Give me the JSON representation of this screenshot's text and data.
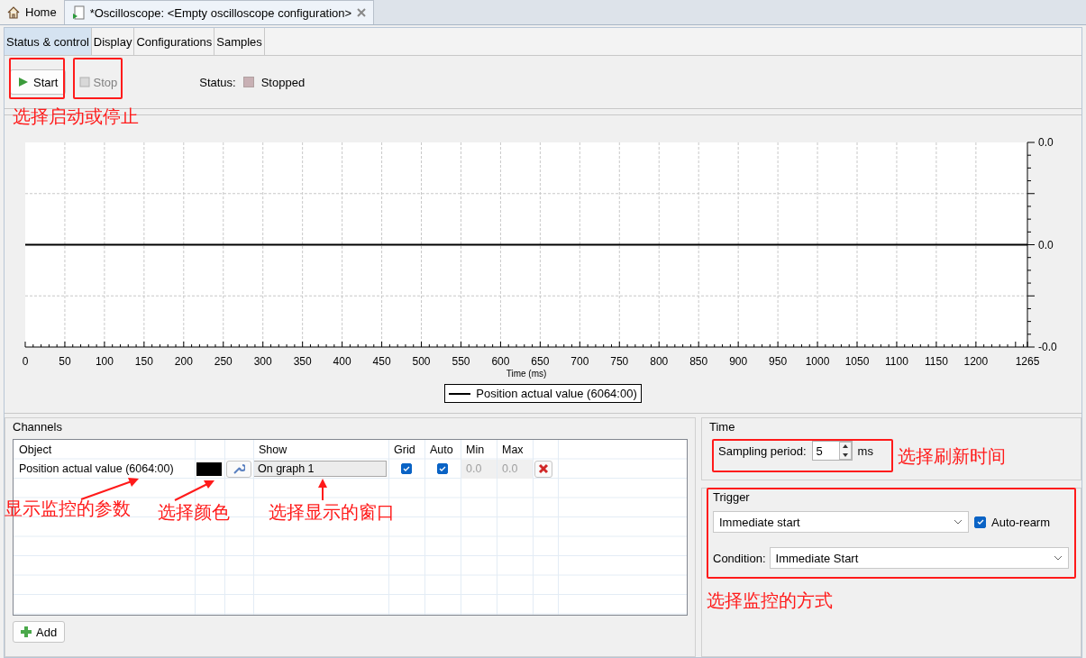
{
  "top_tabs": [
    {
      "label": "Home",
      "selected": false,
      "closable": false
    },
    {
      "label": "*Oscilloscope: <Empty oscilloscope configuration>",
      "selected": true,
      "closable": true
    }
  ],
  "sub_tabs": [
    {
      "label": "Status & control",
      "selected": true
    },
    {
      "label": "Display",
      "selected": false
    },
    {
      "label": "Configurations",
      "selected": false
    },
    {
      "label": "Samples",
      "selected": false
    }
  ],
  "toolbar": {
    "start": {
      "label": "Start",
      "disabled": false
    },
    "stop": {
      "label": "Stop",
      "disabled": true
    },
    "status_label": "Status:",
    "status": "Stopped",
    "running": false
  },
  "chart": {
    "x_tick_labels": [
      "0",
      "50",
      "100",
      "150",
      "200",
      "250",
      "300",
      "350",
      "400",
      "450",
      "500",
      "550",
      "600",
      "650",
      "700",
      "750",
      "800",
      "850",
      "900",
      "950",
      "1000",
      "1050",
      "1100",
      "1150",
      "1200",
      "1265"
    ],
    "x_title": "Time (ms)",
    "y_tick_labels": [
      "0.0",
      "0.0",
      "-0.0"
    ],
    "legend": "Position actual value (6064:00)"
  },
  "channels": {
    "title": "Channels",
    "headers": {
      "object": "Object",
      "show": "Show",
      "grid": "Grid",
      "auto": "Auto",
      "min": "Min",
      "max": "Max"
    },
    "rows": [
      {
        "object": "Position actual value (6064:00)",
        "color": "#000000",
        "show": "On graph 1",
        "grid": true,
        "auto": true,
        "min": "0.0",
        "max": "0.0"
      }
    ],
    "add_button": "Add"
  },
  "time": {
    "title": "Time",
    "label": "Sampling period:",
    "value": "5",
    "unit": "ms"
  },
  "trigger": {
    "title": "Trigger",
    "mode": "Immediate start",
    "auto_rearm": {
      "label": "Auto-rearm",
      "checked": true
    },
    "condition_label": "Condition:",
    "condition": "Immediate Start"
  },
  "annotations": [
    {
      "text": "选择启动或停止"
    },
    {
      "text": "显示监控的参数"
    },
    {
      "text": "选择颜色"
    },
    {
      "text": "选择显示的窗口"
    },
    {
      "text": "选择刷新时间"
    },
    {
      "text": "选择监控的方式"
    }
  ]
}
